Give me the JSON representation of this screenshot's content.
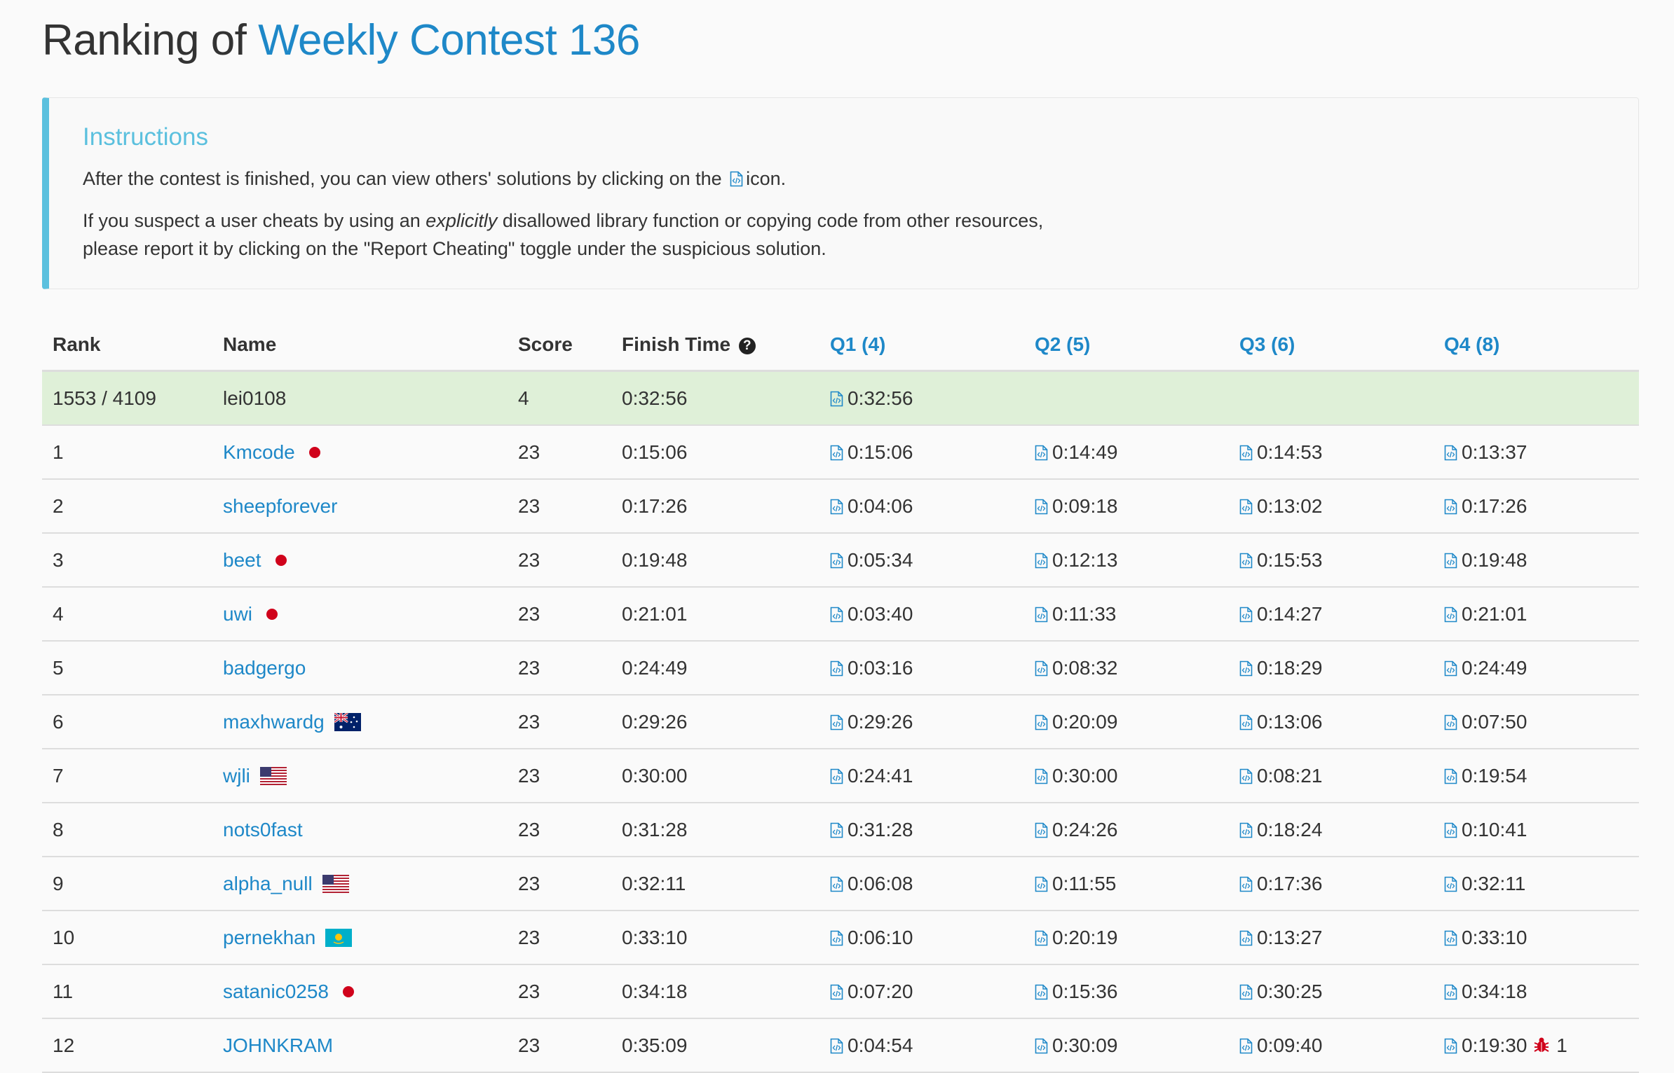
{
  "page": {
    "title_prefix": "Ranking of ",
    "contest_name": "Weekly Contest 136"
  },
  "instructions": {
    "heading": "Instructions",
    "line1_before": "After the contest is finished, you can view others' solutions by clicking on the",
    "line1_after": "icon.",
    "line2_before": "If you suspect a user cheats by using an",
    "line2_emph": "explicitly",
    "line2_after": "disallowed library function or copying code from other resources,",
    "line3": "please report it by clicking on the \"Report Cheating\" toggle under the suspicious solution."
  },
  "table": {
    "headers": {
      "rank": "Rank",
      "name": "Name",
      "score": "Score",
      "finish_time": "Finish Time",
      "q1": "Q1 (4)",
      "q2": "Q2 (5)",
      "q3": "Q3 (6)",
      "q4": "Q4 (8)"
    },
    "my_row": {
      "rank": "1553 / 4109",
      "name": "lei0108",
      "score": "4",
      "finish": "0:32:56",
      "q1": "0:32:56"
    },
    "rows": [
      {
        "rank": "1",
        "name": "Kmcode",
        "badge": "red-dot",
        "score": "23",
        "finish": "0:15:06",
        "q": [
          "0:15:06",
          "0:14:49",
          "0:14:53",
          "0:13:37"
        ]
      },
      {
        "rank": "2",
        "name": "sheepforever",
        "badge": "",
        "score": "23",
        "finish": "0:17:26",
        "q": [
          "0:04:06",
          "0:09:18",
          "0:13:02",
          "0:17:26"
        ]
      },
      {
        "rank": "3",
        "name": "beet",
        "badge": "red-dot",
        "score": "23",
        "finish": "0:19:48",
        "q": [
          "0:05:34",
          "0:12:13",
          "0:15:53",
          "0:19:48"
        ]
      },
      {
        "rank": "4",
        "name": "uwi",
        "badge": "red-dot",
        "score": "23",
        "finish": "0:21:01",
        "q": [
          "0:03:40",
          "0:11:33",
          "0:14:27",
          "0:21:01"
        ]
      },
      {
        "rank": "5",
        "name": "badgergo",
        "badge": "",
        "score": "23",
        "finish": "0:24:49",
        "q": [
          "0:03:16",
          "0:08:32",
          "0:18:29",
          "0:24:49"
        ]
      },
      {
        "rank": "6",
        "name": "maxhwardg",
        "badge": "au-flag",
        "score": "23",
        "finish": "0:29:26",
        "q": [
          "0:29:26",
          "0:20:09",
          "0:13:06",
          "0:07:50"
        ]
      },
      {
        "rank": "7",
        "name": "wjli",
        "badge": "us-flag",
        "score": "23",
        "finish": "0:30:00",
        "q": [
          "0:24:41",
          "0:30:00",
          "0:08:21",
          "0:19:54"
        ]
      },
      {
        "rank": "8",
        "name": "nots0fast",
        "badge": "",
        "score": "23",
        "finish": "0:31:28",
        "q": [
          "0:31:28",
          "0:24:26",
          "0:18:24",
          "0:10:41"
        ]
      },
      {
        "rank": "9",
        "name": "alpha_null",
        "badge": "us-flag",
        "score": "23",
        "finish": "0:32:11",
        "q": [
          "0:06:08",
          "0:11:55",
          "0:17:36",
          "0:32:11"
        ]
      },
      {
        "rank": "10",
        "name": "pernekhan",
        "badge": "kz-flag",
        "score": "23",
        "finish": "0:33:10",
        "q": [
          "0:06:10",
          "0:20:19",
          "0:13:27",
          "0:33:10"
        ]
      },
      {
        "rank": "11",
        "name": "satanic0258",
        "badge": "red-dot",
        "score": "23",
        "finish": "0:34:18",
        "q": [
          "0:07:20",
          "0:15:36",
          "0:30:25",
          "0:34:18"
        ]
      },
      {
        "rank": "12",
        "name": "JOHNKRAM",
        "badge": "",
        "score": "23",
        "finish": "0:35:09",
        "q": [
          "0:04:54",
          "0:30:09",
          "0:09:40",
          "0:19:30"
        ],
        "penalty": "1"
      }
    ]
  },
  "colors": {
    "link": "#1e88c8",
    "accent": "#5bc0de",
    "my_row_bg": "#dff0d8",
    "red_dot": "#d0021b"
  },
  "icons": {
    "solution": "code-file-icon",
    "help": "question-circle-icon",
    "penalty": "bug-icon"
  }
}
